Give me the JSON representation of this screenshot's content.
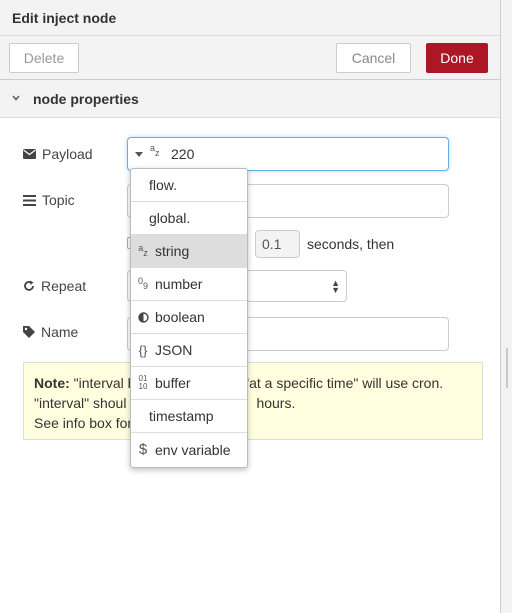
{
  "tray": {
    "title": "Edit inject node"
  },
  "toolbar": {
    "delete_label": "Delete",
    "cancel_label": "Cancel",
    "done_label": "Done"
  },
  "section": {
    "title": "node properties"
  },
  "form": {
    "payload_label": "Payload",
    "payload_value": "220",
    "payload_type_icon": "a z",
    "topic_label": "Topic",
    "once_delay_value": "0.1",
    "once_suffix": "seconds, then",
    "repeat_label": "Repeat",
    "name_label": "Name"
  },
  "note": {
    "prefix": "Note:",
    "line1": "\"interval b",
    "line1b": "d \"at a specific time\" will use cron.",
    "line2": "\"interval\" shoul",
    "line2b": "hours.",
    "line3": "See info box for"
  },
  "dropdown": {
    "options": [
      {
        "label": "flow.",
        "icon": ""
      },
      {
        "label": "global.",
        "icon": ""
      },
      {
        "label": "string",
        "icon": "az"
      },
      {
        "label": "number",
        "icon": "09"
      },
      {
        "label": "boolean",
        "icon": "toggle"
      },
      {
        "label": "JSON",
        "icon": "{}"
      },
      {
        "label": "buffer",
        "icon": "0110"
      },
      {
        "label": "timestamp",
        "icon": ""
      },
      {
        "label": "env variable",
        "icon": "$"
      }
    ],
    "selected_index": 2
  },
  "colors": {
    "done_button": "#ad1625",
    "note_bg": "#ffffe0",
    "focus": "#66afe9"
  }
}
